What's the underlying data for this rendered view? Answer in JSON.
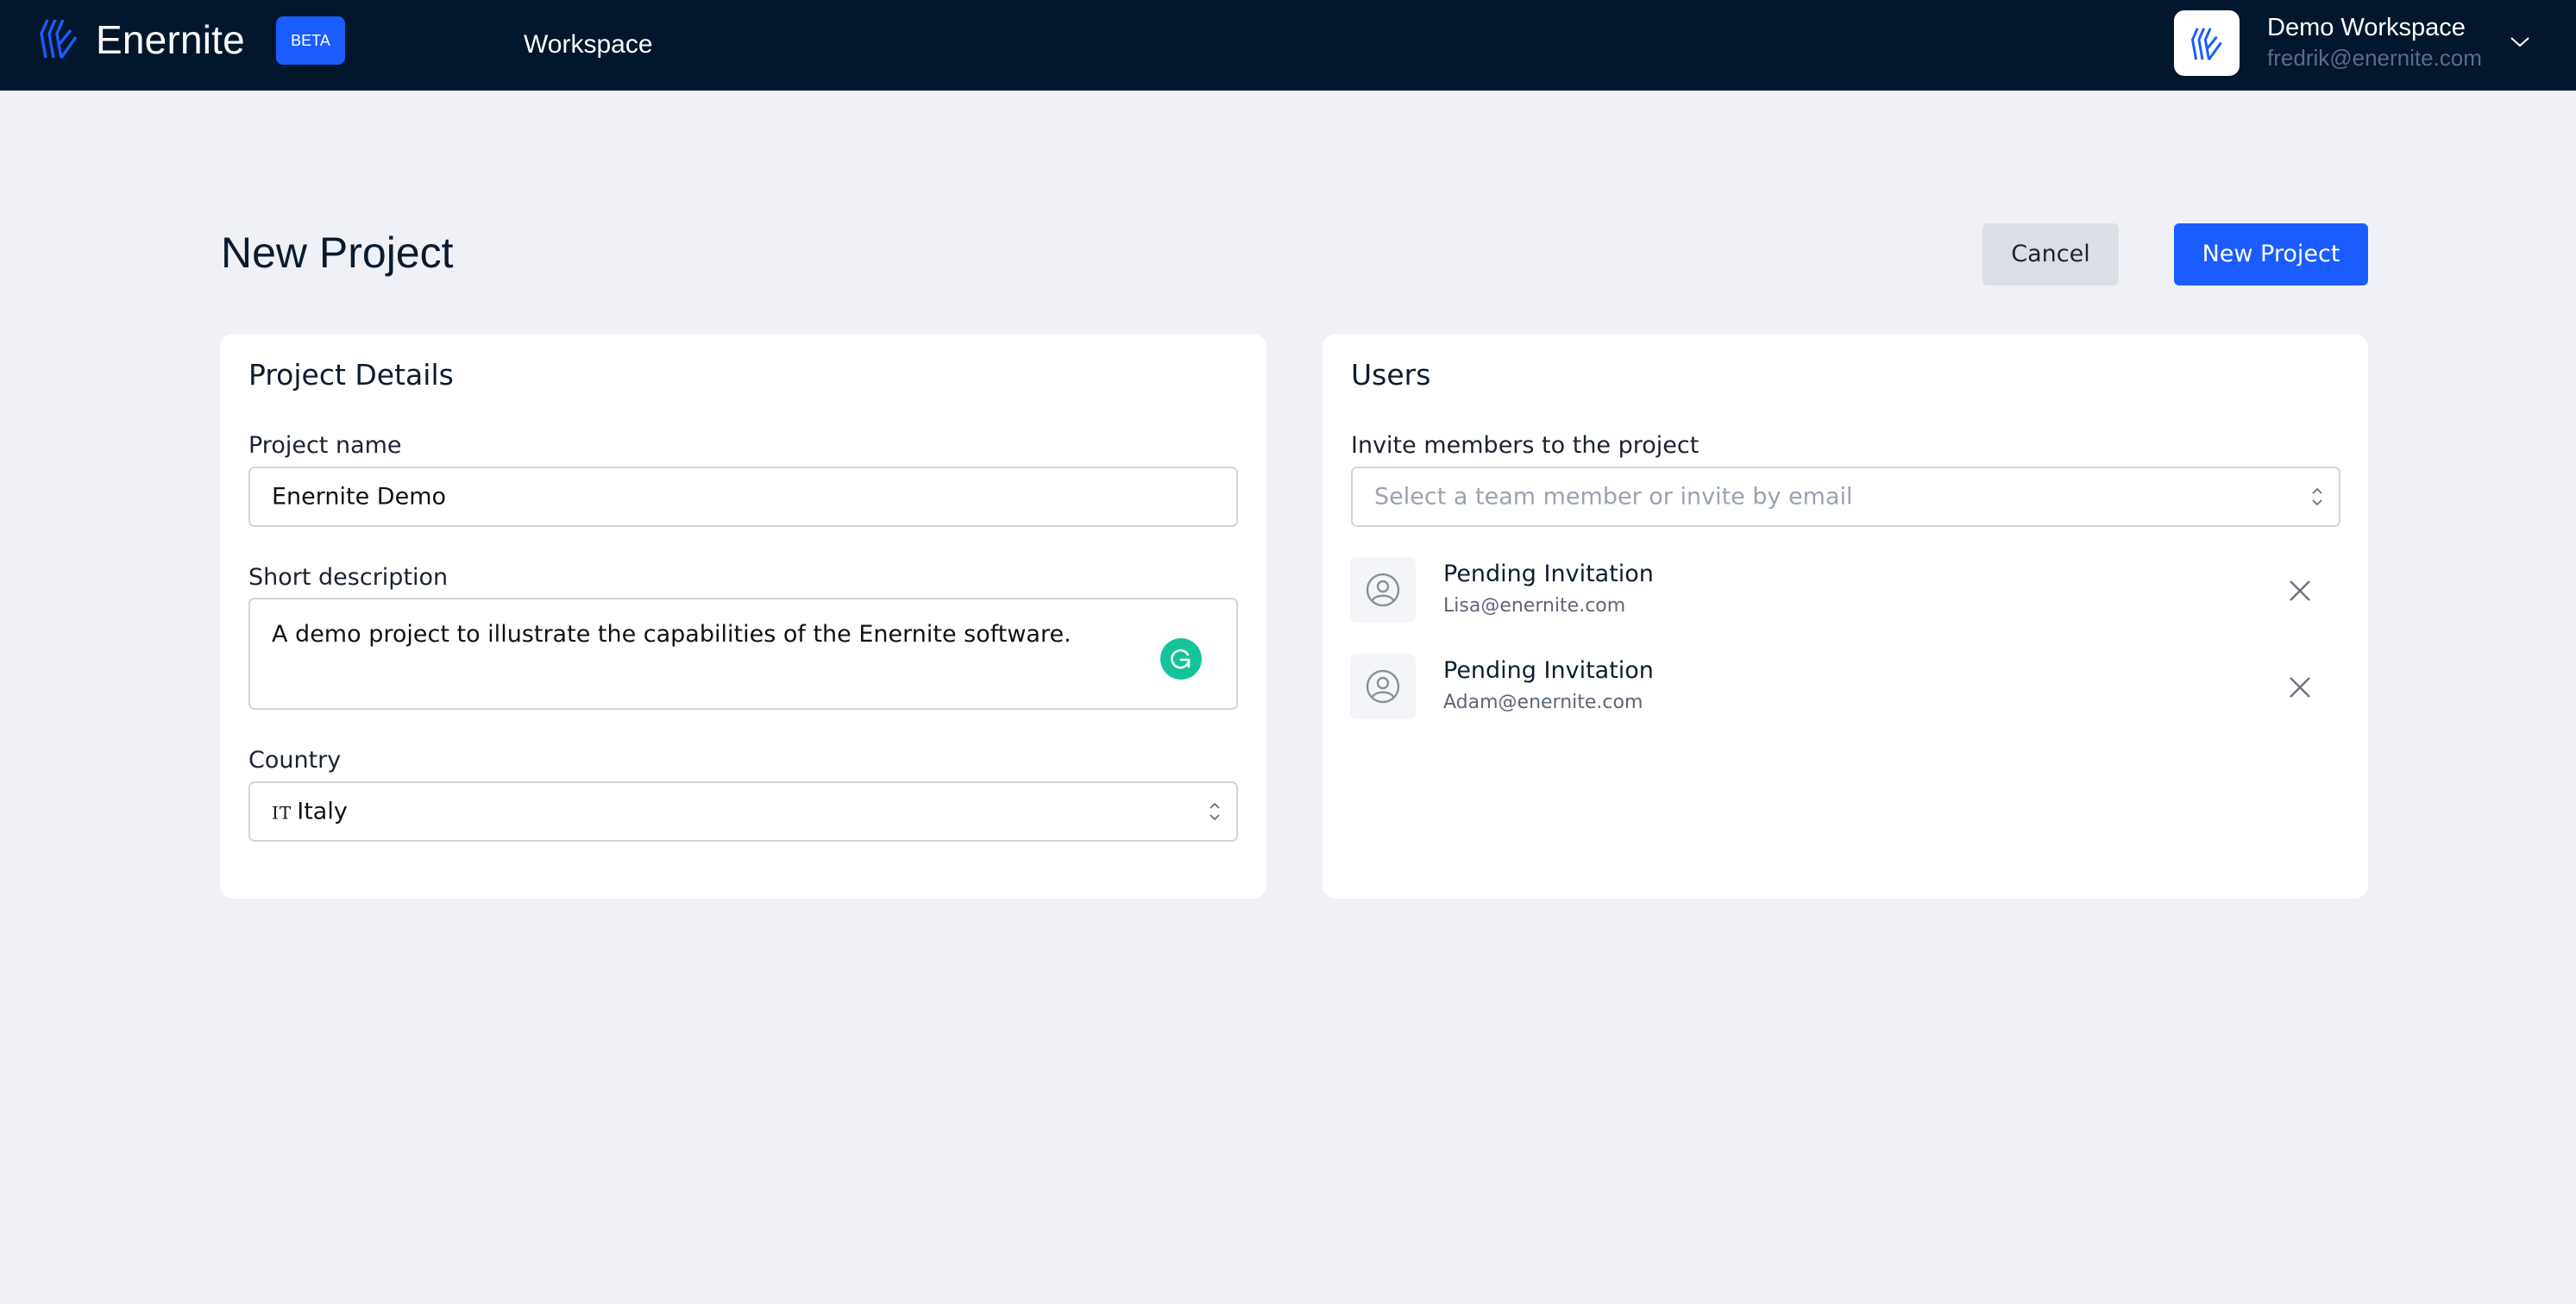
{
  "header": {
    "brand": "Enernite",
    "badge": "BETA",
    "nav": [
      {
        "label": "Workspace"
      }
    ],
    "workspace": {
      "name": "Demo Workspace",
      "email": "fredrik@enernite.com",
      "menu_icon": "chevron-down-icon"
    }
  },
  "page": {
    "title": "New Project",
    "actions": {
      "cancel_label": "Cancel",
      "submit_label": "New Project"
    }
  },
  "details": {
    "title": "Project Details",
    "project_name": {
      "label": "Project name",
      "value": "Enernite Demo"
    },
    "description": {
      "label": "Short description",
      "value": "A demo project to illustrate the capabilities of the Enernite software.",
      "assistant_icon": "grammarly-icon"
    },
    "country": {
      "label": "Country",
      "flag_code": "IT",
      "value": "Italy"
    }
  },
  "users": {
    "title": "Users",
    "invite": {
      "label": "Invite members to the project",
      "placeholder": "Select a team member or invite by email"
    },
    "invitations": [
      {
        "status": "Pending Invitation",
        "email": "Lisa@enernite.com"
      },
      {
        "status": "Pending Invitation",
        "email": "Adam@enernite.com"
      }
    ]
  },
  "colors": {
    "header_bg": "#02172c",
    "accent": "#1a5cff",
    "page_bg": "#f0f1f6",
    "grammarly": "#15c39a"
  }
}
